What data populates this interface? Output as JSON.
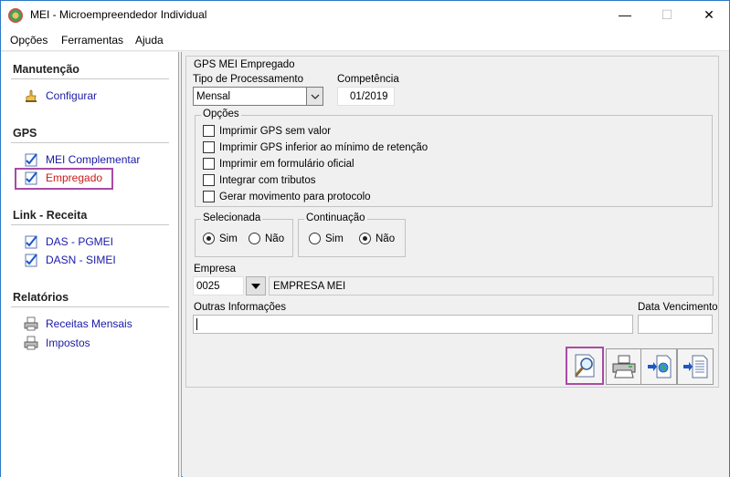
{
  "window": {
    "title": "MEI - Microempreendedor Individual",
    "min_glyph": "—",
    "max_glyph": "☐",
    "close_glyph": "✕"
  },
  "menu": {
    "items": [
      "Opções",
      "Ferramentas",
      "Ajuda"
    ]
  },
  "sidebar": {
    "sections": [
      {
        "title": "Manutenção",
        "items": [
          {
            "label": "Configurar",
            "icon": "hand-config-icon"
          }
        ]
      },
      {
        "title": "GPS",
        "items": [
          {
            "label": "MEI Complementar",
            "icon": "checklist-icon"
          },
          {
            "label": "Empregado",
            "icon": "checklist-icon",
            "active": true
          }
        ]
      },
      {
        "title": "Link - Receita",
        "items": [
          {
            "label": "DAS - PGMEI",
            "icon": "checklist-icon"
          },
          {
            "label": "DASN - SIMEI",
            "icon": "checklist-icon"
          }
        ]
      },
      {
        "title": "Relatórios",
        "items": [
          {
            "label": "Receitas Mensais",
            "icon": "printer-icon"
          },
          {
            "label": "Impostos",
            "icon": "printer-icon"
          }
        ]
      }
    ]
  },
  "form": {
    "panel_title": "GPS MEI Empregado",
    "tipo_label": "Tipo de Processamento",
    "tipo_value": "Mensal",
    "competencia_label": "Competência",
    "competencia_value": "01/2019",
    "opcoes_title": "Opções",
    "opcoes": [
      {
        "label": "Imprimir GPS sem valor",
        "checked": false
      },
      {
        "label": "Imprimir GPS inferior ao mínimo de retenção",
        "checked": false
      },
      {
        "label": "Imprimir em formulário oficial",
        "checked": false
      },
      {
        "label": "Integrar com tributos",
        "checked": false
      },
      {
        "label": "Gerar movimento para protocolo",
        "checked": false
      }
    ],
    "selecionada": {
      "title": "Selecionada",
      "sim": "Sim",
      "nao": "Não",
      "value": "Sim"
    },
    "continuacao": {
      "title": "Continuação",
      "sim": "Sim",
      "nao": "Não",
      "value": "Não"
    },
    "empresa_label": "Empresa",
    "empresa_code": "0025",
    "empresa_name": "EMPRESA MEI",
    "outras_label": "Outras Informações",
    "outras_value": "",
    "vencimento_label": "Data Vencimento",
    "vencimento_value": ""
  },
  "toolbar": {
    "buttons": [
      {
        "name": "preview-button",
        "icon": "magnifier-document-icon"
      },
      {
        "name": "print-button",
        "icon": "printer-icon"
      },
      {
        "name": "export-web-button",
        "icon": "globe-document-icon"
      },
      {
        "name": "export-file-button",
        "icon": "text-document-icon"
      }
    ]
  },
  "colors": {
    "link": "#1a1aa6",
    "active": "#cc1a1a",
    "highlight": "#a94aa6",
    "titlebar_border": "#2b79c7"
  }
}
